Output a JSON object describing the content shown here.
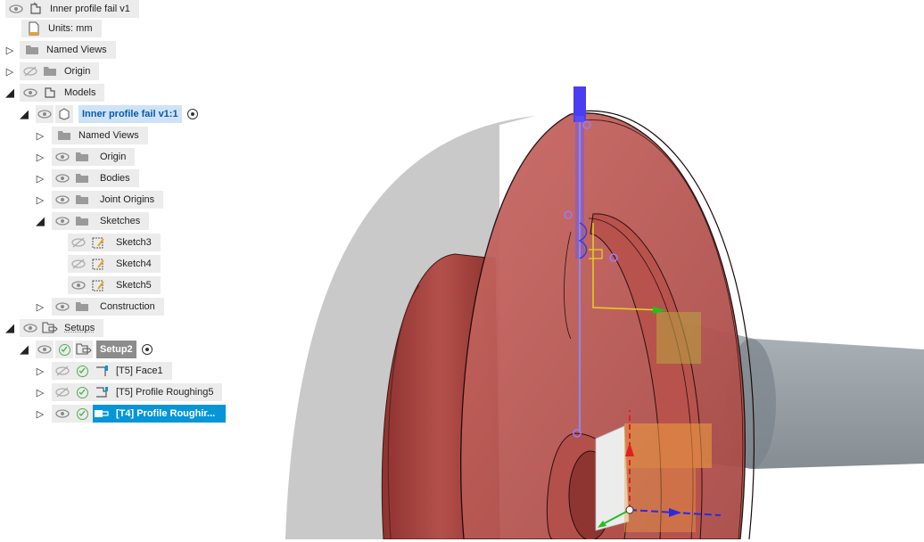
{
  "browser": {
    "root": "Inner profile fail v1",
    "units": "Units: mm",
    "named_views": "Named Views",
    "origin": "Origin",
    "models": "Models",
    "component": "Inner profile fail v1:1",
    "comp_named_views": "Named Views",
    "comp_origin": "Origin",
    "bodies": "Bodies",
    "joint_origins": "Joint Origins",
    "sketches": "Sketches",
    "sketch3": "Sketch3",
    "sketch4": "Sketch4",
    "sketch5": "Sketch5",
    "construction": "Construction",
    "setups": "Setups",
    "setup2": "Setup2",
    "op1": "[T5] Face1",
    "op2": "[T5] Profile Roughing5",
    "op3": "[T4] Profile Roughir..."
  },
  "icons": {
    "eye": "eye-icon",
    "eye_hidden": "eye-hidden-icon",
    "folder": "folder-icon",
    "component": "component-icon",
    "sketch": "sketch-icon",
    "check": "check-circle-icon",
    "units": "units-document-icon"
  },
  "colors": {
    "selection_blue": "#0696d7",
    "light_selection": "#cfe3f8",
    "part_red": "#b5524e",
    "stock_grey": "#8a9199"
  }
}
